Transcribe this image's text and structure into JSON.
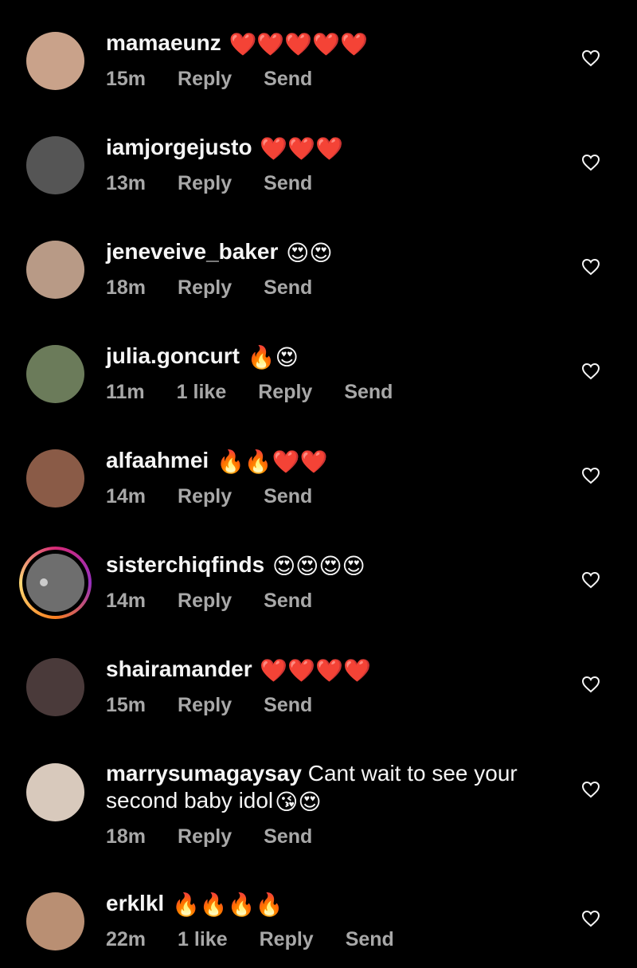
{
  "comments": [
    {
      "username": "mamaeunz",
      "text": "",
      "emojis": "❤️❤️❤️❤️❤️",
      "time": "15m",
      "likes": "",
      "reply": "Reply",
      "send": "Send"
    },
    {
      "username": "iamjorgejusto",
      "text": "",
      "emojis": "❤️❤️❤️",
      "time": "13m",
      "likes": "",
      "reply": "Reply",
      "send": "Send"
    },
    {
      "username": "jeneveive_baker",
      "text": "",
      "emojis": "😍😍",
      "time": "18m",
      "likes": "",
      "reply": "Reply",
      "send": "Send"
    },
    {
      "username": "julia.goncurt",
      "text": "",
      "emojis": "🔥😍",
      "time": "11m",
      "likes": "1 like",
      "reply": "Reply",
      "send": "Send"
    },
    {
      "username": "alfaahmei",
      "text": "",
      "emojis": "🔥🔥❤️❤️",
      "time": "14m",
      "likes": "",
      "reply": "Reply",
      "send": "Send"
    },
    {
      "username": "sisterchiqfinds",
      "text": "",
      "emojis": "😍😍😍😍",
      "time": "14m",
      "likes": "",
      "reply": "Reply",
      "send": "Send"
    },
    {
      "username": "shairamander",
      "text": "",
      "emojis": "❤️❤️❤️❤️",
      "time": "15m",
      "likes": "",
      "reply": "Reply",
      "send": "Send"
    },
    {
      "username": "marrysumagaysay",
      "text": "Cant wait to see your second baby idol",
      "emojis": "😘😍",
      "time": "18m",
      "likes": "",
      "reply": "Reply",
      "send": "Send"
    },
    {
      "username": "erklkl",
      "text": "",
      "emojis": "🔥🔥🔥🔥",
      "time": "22m",
      "likes": "1 like",
      "reply": "Reply",
      "send": "Send"
    }
  ],
  "icons": {
    "like": "heart-outline-icon"
  },
  "colors": {
    "background": "#000000",
    "meta_text": "#a8a8a8",
    "username": "#f5f5f5"
  }
}
